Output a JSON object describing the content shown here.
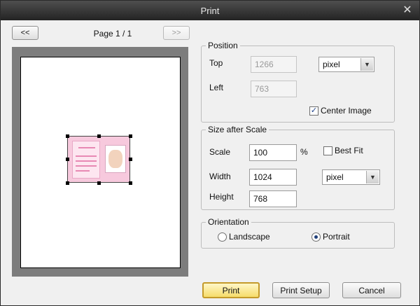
{
  "window": {
    "title": "Print",
    "close_glyph": "✕"
  },
  "nav": {
    "prev_label": "<<",
    "next_label": ">>",
    "page_label": "Page 1 / 1"
  },
  "position": {
    "label": "Position",
    "top_label": "Top",
    "top_value": "1266",
    "left_label": "Left",
    "left_value": "763",
    "unit": "pixel",
    "center_label": "Center Image",
    "center_checked": true
  },
  "size": {
    "label": "Size after Scale",
    "scale_label": "Scale",
    "scale_value": "100",
    "percent": "%",
    "bestfit_label": "Best Fit",
    "bestfit_checked": false,
    "width_label": "Width",
    "width_value": "1024",
    "height_label": "Height",
    "height_value": "768",
    "unit": "pixel"
  },
  "orientation": {
    "label": "Orientation",
    "landscape_label": "Landscape",
    "portrait_label": "Portrait",
    "selected": "Portrait"
  },
  "buttons": {
    "print": "Print",
    "print_setup": "Print Setup",
    "cancel": "Cancel"
  },
  "icons": {
    "check": "✓",
    "dropdown": "▼"
  }
}
